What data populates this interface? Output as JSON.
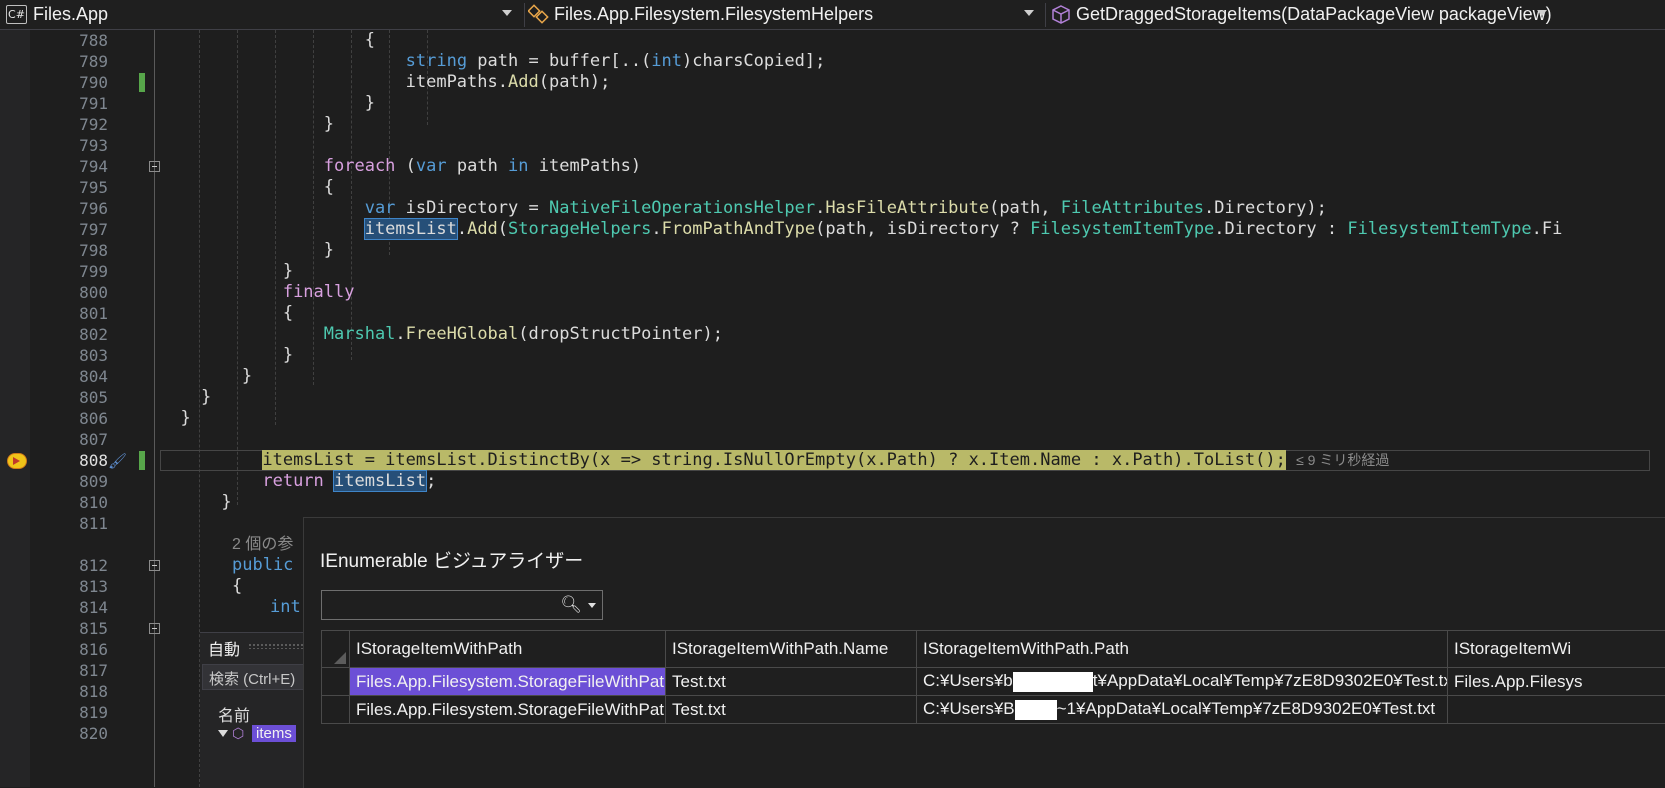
{
  "navbar": {
    "project": "Files.App",
    "type": "Files.App.Filesystem.FilesystemHelpers",
    "member": "GetDraggedStorageItems(DataPackageView packageView)",
    "project_icon": "C#"
  },
  "editor": {
    "lines": [
      {
        "n": "788"
      },
      {
        "n": "789"
      },
      {
        "n": "790"
      },
      {
        "n": "791"
      },
      {
        "n": "792"
      },
      {
        "n": "793"
      },
      {
        "n": "794"
      },
      {
        "n": "795"
      },
      {
        "n": "796"
      },
      {
        "n": "797"
      },
      {
        "n": "798"
      },
      {
        "n": "799"
      },
      {
        "n": "800"
      },
      {
        "n": "801"
      },
      {
        "n": "802"
      },
      {
        "n": "803"
      },
      {
        "n": "804"
      },
      {
        "n": "805"
      },
      {
        "n": "806"
      },
      {
        "n": "807"
      },
      {
        "n": "808"
      },
      {
        "n": "809"
      },
      {
        "n": "810"
      },
      {
        "n": "811"
      },
      {
        "n": "812"
      },
      {
        "n": "813"
      },
      {
        "n": "814"
      },
      {
        "n": "815"
      },
      {
        "n": "816"
      },
      {
        "n": "817"
      },
      {
        "n": "818"
      },
      {
        "n": "819"
      },
      {
        "n": "820"
      }
    ],
    "reference_hint": "2 個の参",
    "partial_code_812": "public s",
    "partial_code_814": "int",
    "elapsed_hint": "≤ 9 ミリ秒経過",
    "current_line": "808"
  },
  "auto_panel": {
    "title": "自動",
    "search_placeholder": "検索 (Ctrl+E)",
    "column_name": "名前",
    "item_name": "items"
  },
  "visualizer": {
    "title": "IEnumerable ビジュアライザー",
    "search_value": "",
    "columns": [
      "IStorageItemWithPath",
      "IStorageItemWithPath.Name",
      "IStorageItemWithPath.Path",
      "IStorageItemWi"
    ],
    "rows": [
      {
        "type": "Files.App.Filesystem.StorageFileWithPath",
        "name": "Test.txt",
        "path_prefix": "C:¥Users¥b",
        "path_suffix": "t¥AppData¥Local¥Temp¥7zE8D9302E0¥Test.txt",
        "extra": "Files.App.Filesys"
      },
      {
        "type": "Files.App.Filesystem.StorageFileWithPath",
        "name": "Test.txt",
        "path_prefix": "C:¥Users¥B",
        "path_suffix": "~1¥AppData¥Local¥Temp¥7zE8D9302E0¥Test.txt",
        "extra": ""
      }
    ]
  },
  "colors": {
    "background": "#1e1e1e",
    "keyword": "#569cd6",
    "control_keyword": "#d8a0df",
    "type": "#4ec9b0",
    "method": "#dcdcaa",
    "selection": "#264f78",
    "current_statement": "#b9b968",
    "grid_selection": "#6c4fd6"
  }
}
